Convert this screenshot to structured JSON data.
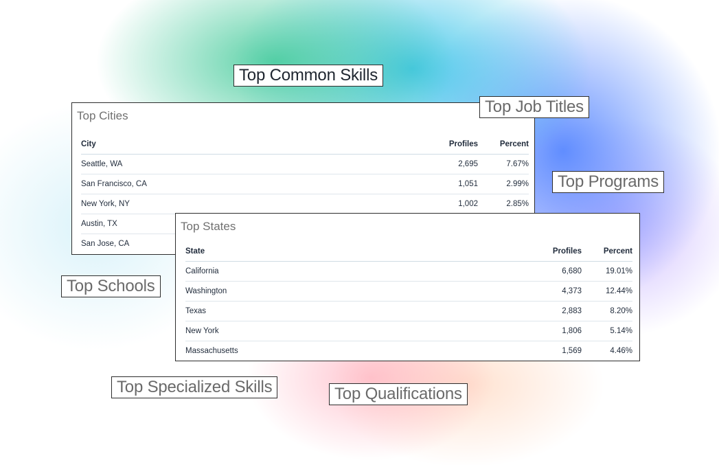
{
  "tags": {
    "common_skills": "Top Common Skills",
    "job_titles": "Top Job Titles",
    "programs": "Top Programs",
    "schools": "Top Schools",
    "specialized_skills": "Top Specialized Skills",
    "qualifications": "Top Qualifications"
  },
  "cities": {
    "title": "Top Cities",
    "headers": {
      "name": "City",
      "profiles": "Profiles",
      "percent": "Percent"
    },
    "rows": [
      {
        "name": "Seattle, WA",
        "profiles": "2,695",
        "percent": "7.67%"
      },
      {
        "name": "San Francisco, CA",
        "profiles": "1,051",
        "percent": "2.99%"
      },
      {
        "name": "New York, NY",
        "profiles": "1,002",
        "percent": "2.85%"
      },
      {
        "name": "Austin, TX",
        "profiles": "",
        "percent": ""
      },
      {
        "name": "San Jose, CA",
        "profiles": "",
        "percent": ""
      }
    ]
  },
  "states": {
    "title": "Top States",
    "headers": {
      "name": "State",
      "profiles": "Profiles",
      "percent": "Percent"
    },
    "rows": [
      {
        "name": "California",
        "profiles": "6,680",
        "percent": "19.01%"
      },
      {
        "name": "Washington",
        "profiles": "4,373",
        "percent": "12.44%"
      },
      {
        "name": "Texas",
        "profiles": "2,883",
        "percent": "8.20%"
      },
      {
        "name": "New York",
        "profiles": "1,806",
        "percent": "5.14%"
      },
      {
        "name": "Massachusetts",
        "profiles": "1,569",
        "percent": "4.46%"
      }
    ]
  }
}
